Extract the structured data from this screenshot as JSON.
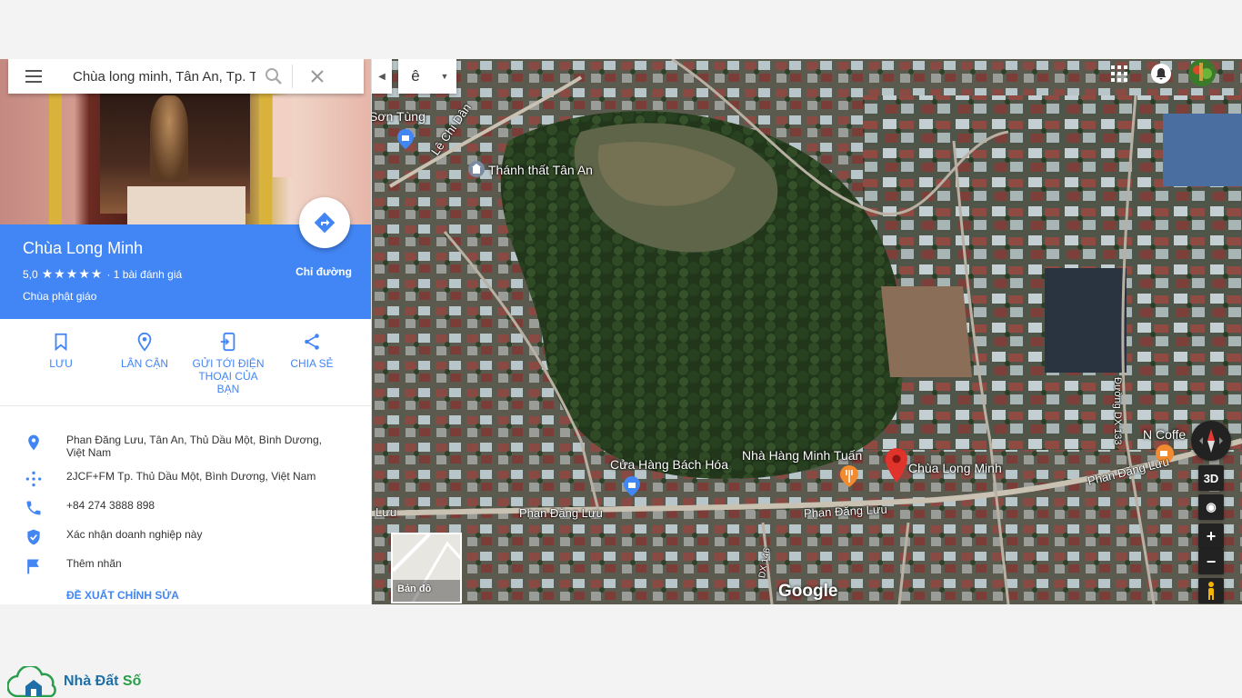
{
  "search": {
    "query": "Chùa long minh, Tân An, Tp. Thủ",
    "menu_icon": "menu-icon",
    "search_icon": "search-icon",
    "clear_icon": "close-icon"
  },
  "place": {
    "name": "Chùa Long Minh",
    "rating": "5,0",
    "stars": "★★★★★",
    "reviews": "· 1 bài đánh giá",
    "category": "Chùa phật giáo",
    "directions_label": "Chỉ đường"
  },
  "actions": [
    {
      "label": "LƯU",
      "icon": "bookmark-icon"
    },
    {
      "label": "LÂN CẬN",
      "icon": "nearby-icon"
    },
    {
      "label": "GỬI TỚI ĐIỆN THOẠI CỦA BẠN",
      "icon": "send-to-phone-icon"
    },
    {
      "label": "CHIA SẺ",
      "icon": "share-icon"
    }
  ],
  "info": {
    "address": "Phan Đăng Lưu, Tân An, Thủ Dầu Một, Bình Dương, Việt Nam",
    "plus_code": "2JCF+FM Tp. Thủ Dầu Một, Bình Dương, Việt Nam",
    "phone": "+84 274 3888 898",
    "claim": "Xác nhận doanh nghiệp này",
    "label": "Thêm nhãn",
    "suggest_edit": "ĐỀ XUẤT CHỈNH SỬA"
  },
  "map": {
    "ime_char": "ê",
    "labels": {
      "son_tung": "Sơn Tùng",
      "thanh_that": "Thánh thất Tân An",
      "le_chi_dan": "Lê Chí Dân",
      "cua_hang": "Cửa Hàng Bách Hóa",
      "nha_hang": "Nhà Hàng Minh Tuấn",
      "chua": "Chùa Long Minh",
      "n_coffee": "N Coffe",
      "road_1": "Phan Đăng Lưu",
      "road_2": "Phan Đăng Lưu",
      "road_3": "Phan Đăng Lưu",
      "road_4": "Phan Đăng Lưu",
      "road_left": "Lưu",
      "dx133": "Đường DX 133",
      "dx146": "DX 146"
    },
    "controls": {
      "three_d": "3D",
      "zoom_in": "+",
      "zoom_out": "−"
    },
    "minimap_label": "Bản đồ",
    "brand": "Google",
    "accent": "#4285f4"
  },
  "footer": {
    "logo_main": "Nhà Đất ",
    "logo_accent": "Số"
  }
}
